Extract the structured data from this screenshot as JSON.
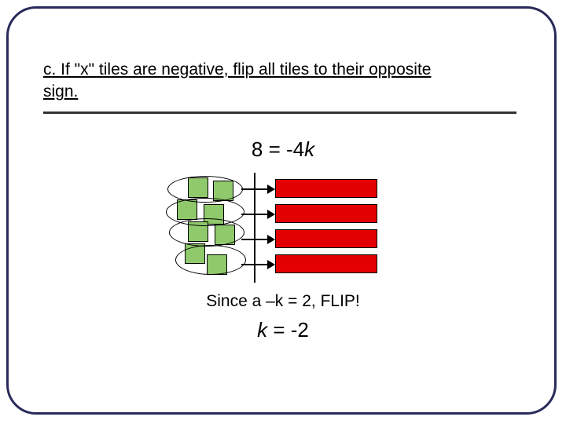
{
  "title": {
    "prefix": "c. If \"x\" tiles are negative, flip all tiles to their opposite",
    "suffix": "sign."
  },
  "equation_top_left": "8 = -4",
  "equation_top_var": "k",
  "line_since": "Since a –k = 2, FLIP!",
  "result_var": "k",
  "result_rest": " = -2",
  "diagram": {
    "green_unit_tiles": 8,
    "groups": 4,
    "red_bars": 4,
    "arrows": 4
  }
}
